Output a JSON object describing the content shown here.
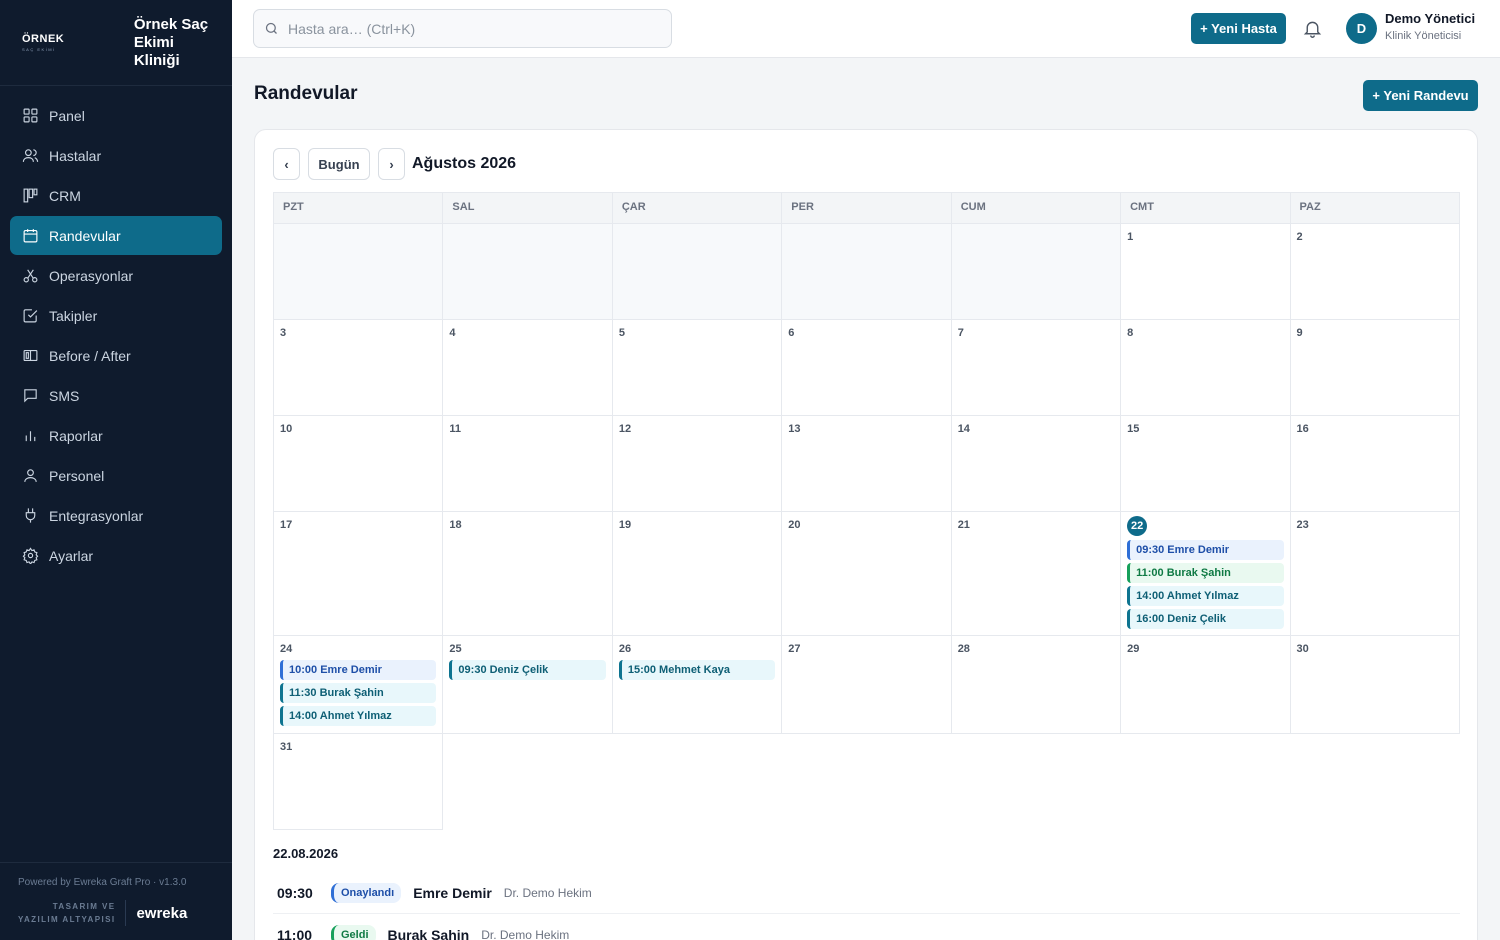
{
  "clinic": {
    "logo_line1": "ÖRNEK",
    "logo_line2": "SAÇ EKİMİ",
    "name": "Örnek Saç Ekimi Kliniği"
  },
  "sidebar": {
    "items": [
      {
        "label": "Panel",
        "icon": "grid-icon"
      },
      {
        "label": "Hastalar",
        "icon": "users-icon"
      },
      {
        "label": "CRM",
        "icon": "kanban-icon"
      },
      {
        "label": "Randevular",
        "icon": "calendar-icon",
        "active": true
      },
      {
        "label": "Operasyonlar",
        "icon": "scissors-icon"
      },
      {
        "label": "Takipler",
        "icon": "check-square-icon"
      },
      {
        "label": "Before / After",
        "icon": "compare-icon"
      },
      {
        "label": "SMS",
        "icon": "message-icon"
      },
      {
        "label": "Raporlar",
        "icon": "bar-chart-icon"
      },
      {
        "label": "Personel",
        "icon": "user-icon"
      },
      {
        "label": "Entegrasyonlar",
        "icon": "plug-icon"
      },
      {
        "label": "Ayarlar",
        "icon": "gear-icon"
      }
    ],
    "footer": {
      "powered": "Powered by Ewreka Graft Pro · v1.3.0",
      "tasarim_line1": "TASARIM VE",
      "tasarim_line2": "YAZILIM ALTYAPISI",
      "brand": "ewreka"
    }
  },
  "topbar": {
    "search_placeholder": "Hasta ara… (Ctrl+K)",
    "new_patient_label": "+ Yeni Hasta",
    "user": {
      "initial": "D",
      "name": "Demo Yönetici",
      "role": "Klinik Yöneticisi"
    }
  },
  "page": {
    "title": "Randevular",
    "new_appointment_label": "+ Yeni Randevu"
  },
  "calendar": {
    "prev": "‹",
    "today_label": "Bugün",
    "next": "›",
    "month_label": "Ağustos 2026",
    "weekdays": [
      "PZT",
      "SAL",
      "ÇAR",
      "PER",
      "CUM",
      "CMT",
      "PAZ"
    ],
    "events": {
      "22": [
        {
          "text": "09:30 Emre Demir",
          "color": "blue"
        },
        {
          "text": "11:00 Burak Şahin",
          "color": "green"
        },
        {
          "text": "14:00 Ahmet Yılmaz",
          "color": "teal"
        },
        {
          "text": "16:00 Deniz Çelik",
          "color": "teal"
        }
      ],
      "24": [
        {
          "text": "10:00 Emre Demir",
          "color": "blue"
        },
        {
          "text": "11:30 Burak Şahin",
          "color": "teal"
        },
        {
          "text": "14:00 Ahmet Yılmaz",
          "color": "teal"
        }
      ],
      "25": [
        {
          "text": "09:30 Deniz Çelik",
          "color": "teal"
        }
      ],
      "26": [
        {
          "text": "15:00 Mehmet Kaya",
          "color": "teal"
        }
      ]
    }
  },
  "day_detail": {
    "date": "22.08.2026",
    "rows": [
      {
        "time": "09:30",
        "status": "Onaylandı",
        "status_color": "blue",
        "patient": "Emre Demir",
        "doctor": "Dr. Demo Hekim"
      },
      {
        "time": "11:00",
        "status": "Geldi",
        "status_color": "green",
        "patient": "Burak Şahin",
        "doctor": "Dr. Demo Hekim"
      }
    ]
  },
  "colors": {
    "accent": "#0e6b8a",
    "sidebar_bg": "#0f1b2d"
  }
}
